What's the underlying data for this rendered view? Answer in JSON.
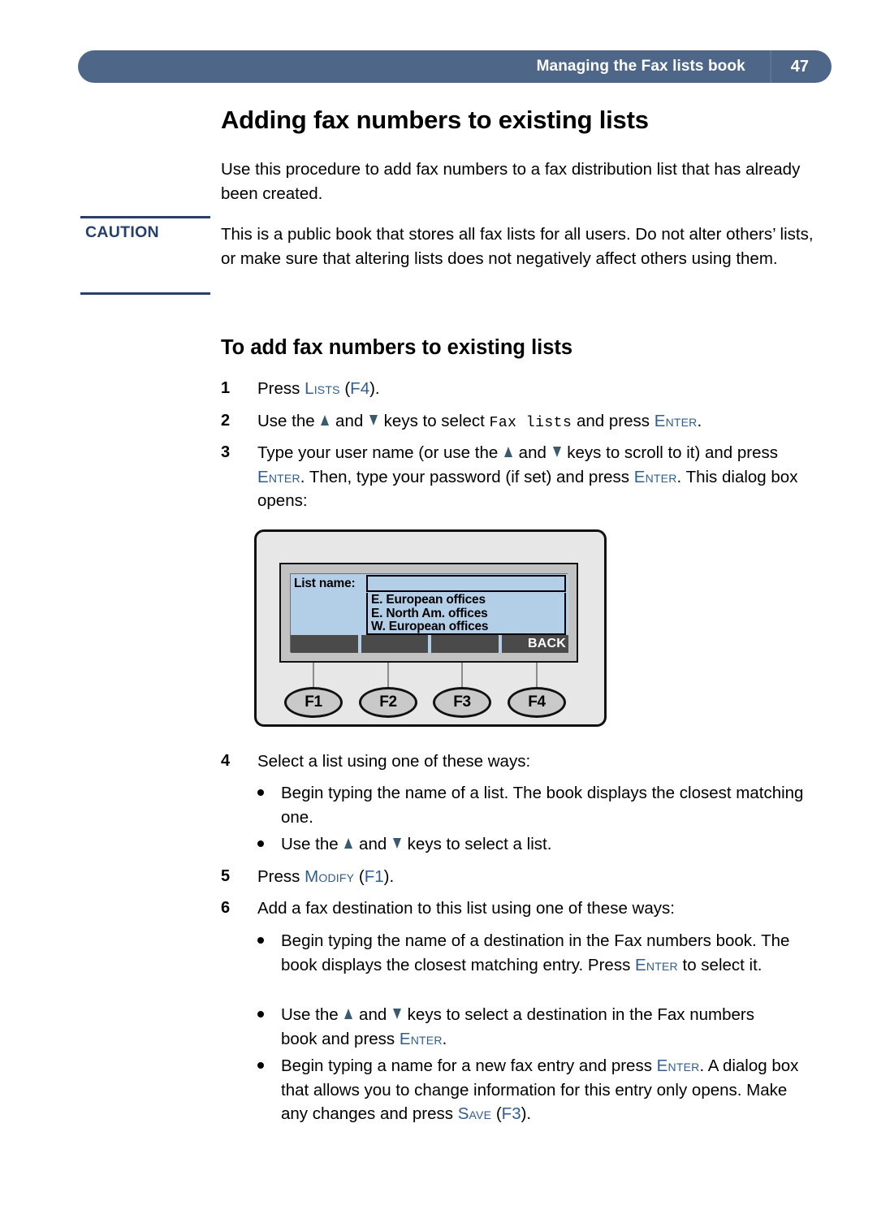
{
  "header": {
    "title": "Managing the Fax lists book",
    "page_number": "47",
    "bar_color": "#4e6788"
  },
  "page": {
    "h1": "Adding fax numbers to existing lists",
    "intro": "Use this procedure to add fax numbers to a fax distribution list that has already been created.",
    "h2": "To add fax numbers to existing lists"
  },
  "caution": {
    "label": "CAUTION",
    "label_color": "#27406b",
    "text": "This is a public book that stores all fax lists for all users. Do not alter others’ lists, or make sure that altering lists does not negatively affect others using them."
  },
  "steps": {
    "s1": {
      "num": "1",
      "a": "Press ",
      "key1": "Lists",
      "b": " (",
      "fkey1": "F4",
      "c": ")."
    },
    "s2": {
      "num": "2",
      "a": "Use the ",
      "b": " and ",
      "c": " keys to select ",
      "mono": "Fax lists",
      "d": " and press ",
      "key1": "Enter",
      "e": "."
    },
    "s3": {
      "num": "3",
      "a": "Type your user name (or use the ",
      "b": " and ",
      "c": " keys to scroll to it) and press ",
      "key1": "Enter",
      "d": ". Then, type your password (if set) and press ",
      "key2": "Enter",
      "e": ". This dialog box opens:"
    },
    "s4": {
      "num": "4",
      "a": "Select a list using one of these ways:"
    },
    "s5": {
      "num": "5",
      "a": "Press ",
      "key1": "Modify",
      "b": " (",
      "fkey1": "F1",
      "c": ")."
    },
    "s6": {
      "num": "6",
      "a": "Add a fax destination to this list using one of these ways:"
    }
  },
  "bullets": {
    "b1": {
      "a": "Begin typing the name of a list. The book displays the closest matching one."
    },
    "b2": {
      "a": "Use the ",
      "b": " and ",
      "c": " keys to select a list."
    },
    "b3": {
      "a": "Begin typing the name of a destination in the Fax numbers book. The book displays the closest matching entry. Press ",
      "key1": "Enter",
      "b": " to select it."
    },
    "b4": {
      "a": "Use the ",
      "b": " and ",
      "c": " keys to select a destination in the Fax numbers book and press ",
      "key1": "Enter",
      "d": "."
    },
    "b5": {
      "a": "Begin typing a name for a new fax entry and press ",
      "key1": "Enter",
      "b": ". A dialog box that allows you to change information for this entry only opens. Make any changes and press ",
      "key2": "Save",
      "c": " (",
      "fkey1": "F3",
      "d": ")."
    }
  },
  "device": {
    "screen_bg": "#b3cfe8",
    "body_bg": "#e7e7e7",
    "lcd": {
      "field_label": "List name:",
      "field_value": "",
      "list_items": [
        "E. European offices",
        "E. North Am. offices",
        "W. European offices"
      ]
    },
    "softkeys": [
      {
        "label": ""
      },
      {
        "label": ""
      },
      {
        "label": ""
      },
      {
        "label": "BACK"
      }
    ],
    "function_keys": [
      {
        "label": "F1"
      },
      {
        "label": "F2"
      },
      {
        "label": "F3"
      },
      {
        "label": "F4"
      }
    ]
  }
}
